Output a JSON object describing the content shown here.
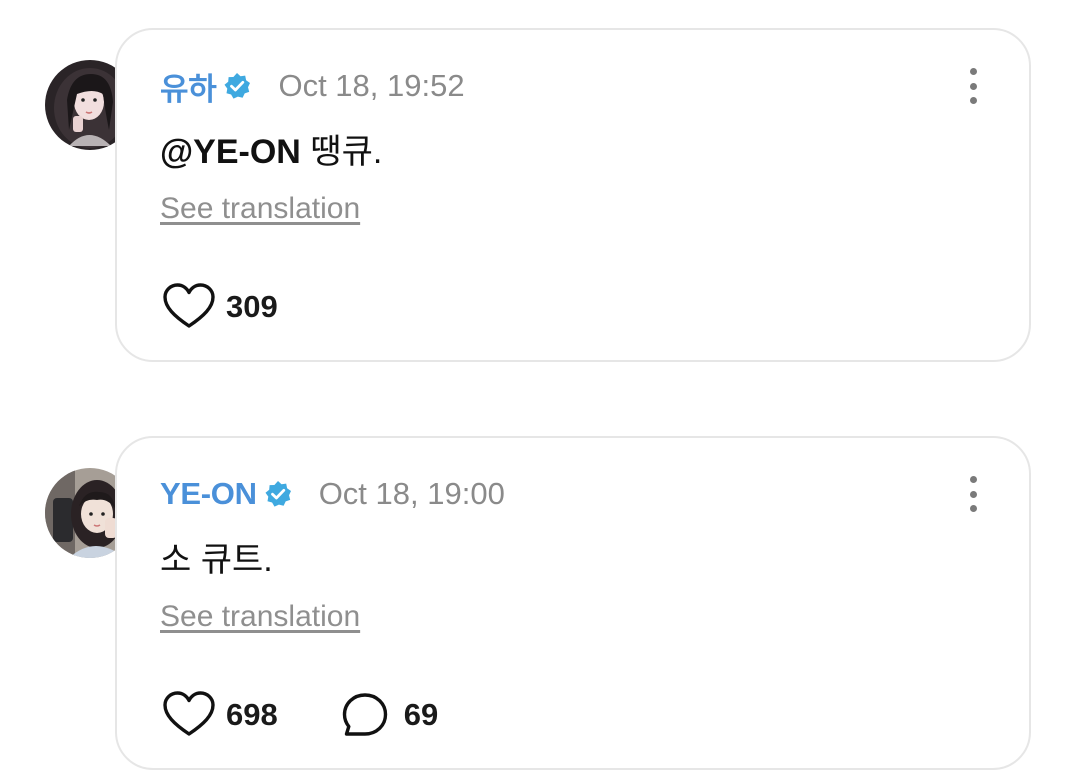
{
  "posts": [
    {
      "author": "유하",
      "timestamp": "Oct 18, 19:52",
      "mention": "@YE-ON",
      "text": " 땡큐.",
      "translation_label": "See translation",
      "likes": "309",
      "name_color": "#4a90d9",
      "avatar_icon": "avatar-yuha"
    },
    {
      "author": "YE-ON",
      "timestamp": "Oct 18, 19:00",
      "mention": "",
      "text": "소 큐트.",
      "translation_label": "See translation",
      "likes": "698",
      "comments": "69",
      "name_color": "#4a90d9",
      "avatar_icon": "avatar-yeon"
    }
  ],
  "colors": {
    "name": "#4a90d9",
    "verified": "#3fa9e0",
    "timestamp": "#8a8a8a",
    "card_border": "#e6e6e6"
  }
}
